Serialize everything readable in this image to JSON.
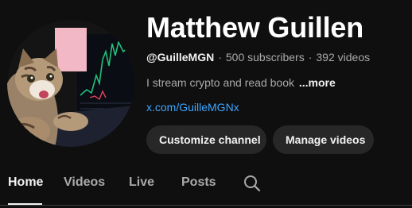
{
  "channel": {
    "name": "Matthew Guillen",
    "handle": "@GuilleMGN",
    "subscribers": "500 subscribers",
    "videos": "392 videos",
    "separator": "·",
    "description": "I stream crypto and read book",
    "more_label": "...more",
    "link": "x.com/GuilleMGNx"
  },
  "actions": {
    "customize_label": "Customize channel",
    "manage_label": "Manage videos"
  },
  "tabs": [
    {
      "label": "Home",
      "active": true
    },
    {
      "label": "Videos",
      "active": false
    },
    {
      "label": "Live",
      "active": false
    },
    {
      "label": "Posts",
      "active": false
    }
  ],
  "icons": {
    "search": "search-icon"
  },
  "colors": {
    "background": "#0f0f0f",
    "button_bg": "#272727",
    "link": "#3ea6ff",
    "secondary_text": "#aaaaaa"
  }
}
